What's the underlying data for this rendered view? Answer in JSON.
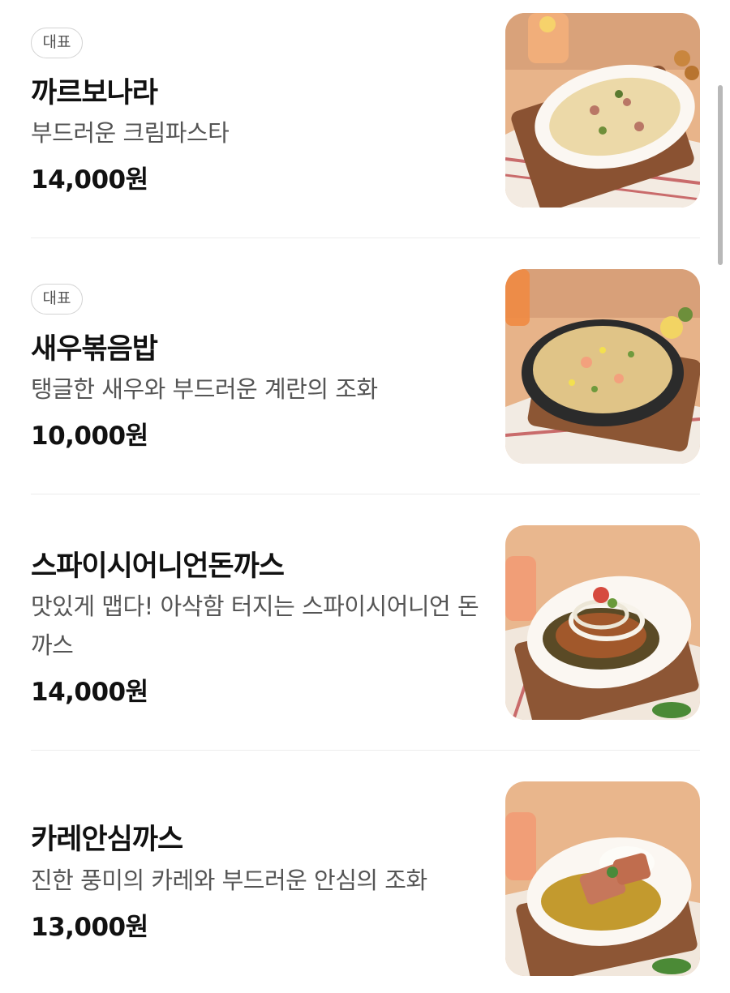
{
  "menu": {
    "items": [
      {
        "badge": "대표",
        "name": "까르보나라",
        "description": "부드러운 크림파스타",
        "price": "14,000원",
        "image": "creamy carbonara pasta on oval plate"
      },
      {
        "badge": "대표",
        "name": "새우볶음밥",
        "description": "탱글한 새우와 부드러운 계란의 조화",
        "price": "10,000원",
        "image": "shrimp fried rice in black skillet"
      },
      {
        "name": "스파이시어니언돈까스",
        "description": "맛있게 맵다! 아삭함 터지는 스파이시어니언 돈까스",
        "price": "14,000원",
        "image": "pork cutlet topped with sliced onions"
      },
      {
        "name": "카레안심까스",
        "description": "진한 풍미의 카레와 부드러운 안심의 조화",
        "price": "13,000원",
        "image": "tenderloin cutlet with curry and rice"
      }
    ]
  },
  "colors": {
    "text_primary": "#111111",
    "text_secondary": "#555555",
    "badge_border": "#d3d3d3",
    "divider": "#ececec",
    "photo_background": "#e8b48a"
  }
}
